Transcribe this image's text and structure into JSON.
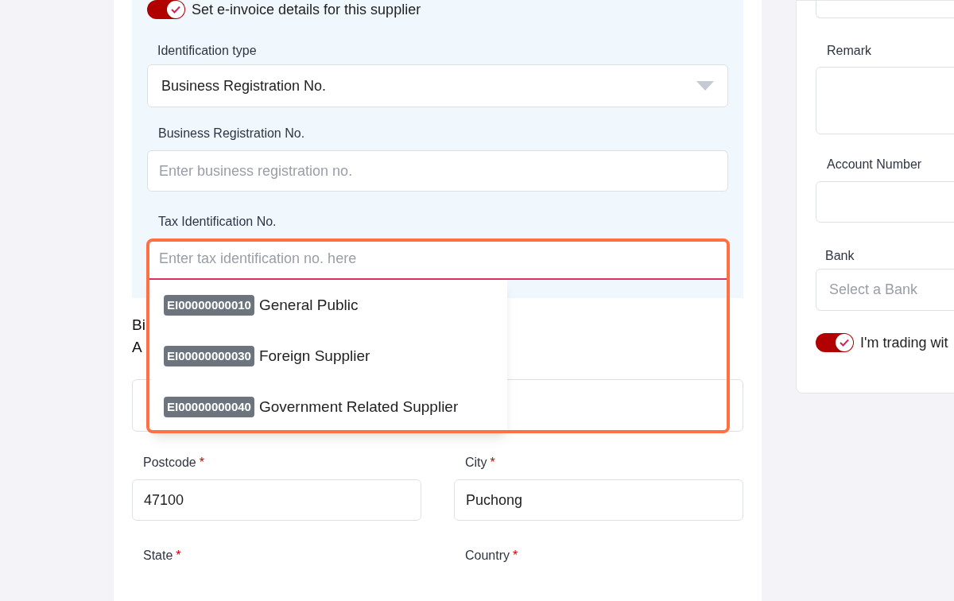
{
  "einvoice": {
    "toggle": {
      "label": "Set e-invoice details for this supplier",
      "on": true
    },
    "identification_type": {
      "label": "Identification type",
      "value": "Business Registration No."
    },
    "business_registration": {
      "label": "Business Registration No.",
      "placeholder": "Enter business registration no."
    },
    "tax_identification": {
      "label": "Tax Identification No.",
      "placeholder": "Enter tax identification no. here",
      "suggestions": [
        {
          "code": "EI00000000010",
          "name": "General Public"
        },
        {
          "code": "EI00000000030",
          "name": "Foreign Supplier"
        },
        {
          "code": "EI00000000040",
          "name": "Government Related Supplier"
        }
      ]
    }
  },
  "billing_address": {
    "heading_lines": [
      "Bi",
      "A"
    ],
    "fields": [
      {
        "label": "Postcode",
        "required_mark": "*",
        "value": "47100"
      },
      {
        "label": "City",
        "required_mark": "*",
        "value": "Puchong"
      }
    ],
    "next_labels": [
      {
        "label": "State",
        "required_mark": "*"
      },
      {
        "label": "Country",
        "required_mark": "*"
      }
    ]
  },
  "side": {
    "remark": {
      "label": "Remark"
    },
    "account_number": {
      "label": "Account Number"
    },
    "bank": {
      "label": "Bank",
      "placeholder": "Select a Bank"
    },
    "trading_toggle": {
      "label": "I'm trading wit",
      "on": true
    }
  }
}
